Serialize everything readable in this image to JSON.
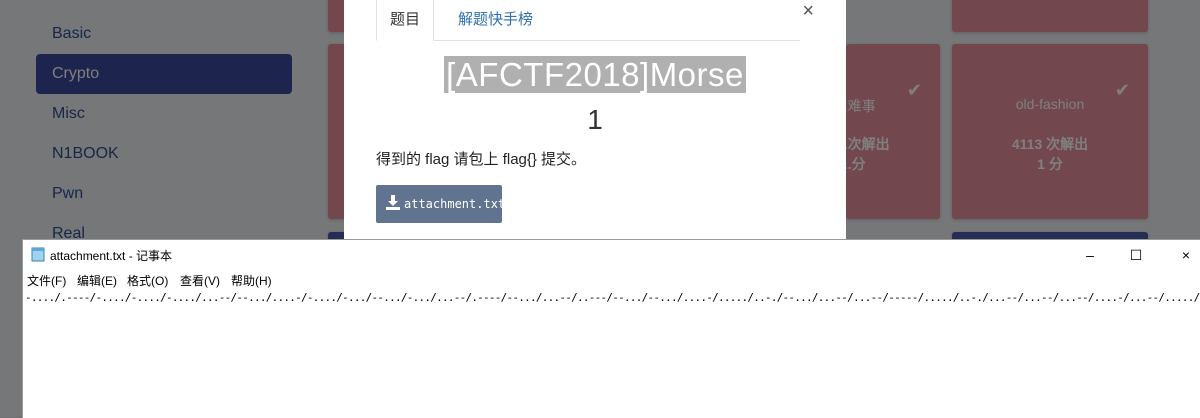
{
  "sidebar": {
    "items": [
      {
        "label": "Basic"
      },
      {
        "label": "Crypto"
      },
      {
        "label": "Misc"
      },
      {
        "label": "N1BOOK"
      },
      {
        "label": "Pwn"
      },
      {
        "label": "Real"
      }
    ]
  },
  "tiles": {
    "left": {
      "title": "...难事",
      "solves": "...次解出",
      "score": "...分"
    },
    "right": {
      "title": "old-fashion",
      "solves": "4113 次解出",
      "score": "1 分"
    }
  },
  "modal": {
    "tabs": [
      {
        "label": "题目"
      },
      {
        "label": "解题快手榜"
      }
    ],
    "close_symbol": "×",
    "title": "[AFCTF2018]Morse",
    "score": "1",
    "description": "得到的 flag 请包上 flag{} 提交。",
    "attachment_label": "attachment.txt"
  },
  "notepad": {
    "title": "attachment.txt - 记事本",
    "menu": [
      {
        "label": "文件(F)"
      },
      {
        "label": "编辑(E)"
      },
      {
        "label": "格式(O)"
      },
      {
        "label": "查看(V)"
      },
      {
        "label": "帮助(H)"
      }
    ],
    "content": "-..../.----/-..../-..../-..../...--/--.../....-/-..../-.../--.../-.../...--/.----/--.../...--/..---/--.../--.../....-/...../..-./--.../...--/...--/-----/...../..-./...--/...--/...--/....-/...--/...../--.../----./",
    "window_buttons": {
      "minimize": "–",
      "maximize": "☐",
      "close": "×"
    }
  },
  "colors": {
    "sidebar_active": "#3b4a9c",
    "tile_pink": "#e58f9d",
    "tab_link": "#2f6fb0",
    "download_button": "#61748f"
  }
}
